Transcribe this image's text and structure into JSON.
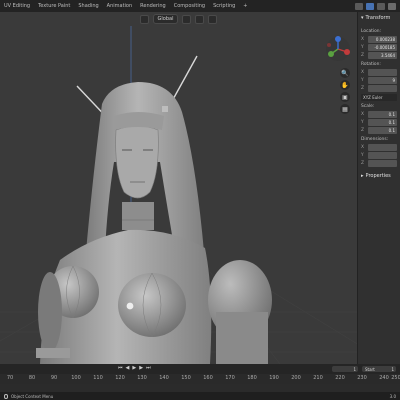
{
  "menu": {
    "tabs": [
      "UV Editing",
      "Texture Paint",
      "Shading",
      "Animation",
      "Rendering",
      "Compositing",
      "Scripting",
      "+"
    ]
  },
  "viewport": {
    "orientation_label": "Global",
    "model": "robot-woman bust",
    "gizmo": {
      "x": "X",
      "y": "Y",
      "z": "Z"
    }
  },
  "npanel": {
    "section_title": "Transform",
    "location_label": "Location:",
    "location": {
      "x": "0.000238",
      "y": "-0.000185",
      "z": "3.5464"
    },
    "rotation_label": "Rotation:",
    "rotation": {
      "x": "",
      "y": "9",
      "z": ""
    },
    "rotation_mode": "XYZ Euler",
    "scale_label": "Scale:",
    "scale": {
      "x": "0.1",
      "y": "0.1",
      "z": "0.1"
    },
    "dimensions_label": "Dimensions:",
    "dimensions": {
      "x": "",
      "y": "",
      "z": ""
    },
    "properties_label": "Properties"
  },
  "timeline": {
    "current_frame": "1",
    "start_label": "Start",
    "start_value": "1",
    "ruler": [
      "70",
      "80",
      "90",
      "100",
      "110",
      "120",
      "130",
      "140",
      "150",
      "160",
      "170",
      "180",
      "190",
      "200",
      "210",
      "220",
      "230",
      "240",
      "250"
    ]
  },
  "status": {
    "message": "Object Context Menu",
    "right": "3.0"
  },
  "colors": {
    "accent": "#4772b3",
    "viewport_bg": "#3a3a3a",
    "model": "#9e9e9e"
  }
}
